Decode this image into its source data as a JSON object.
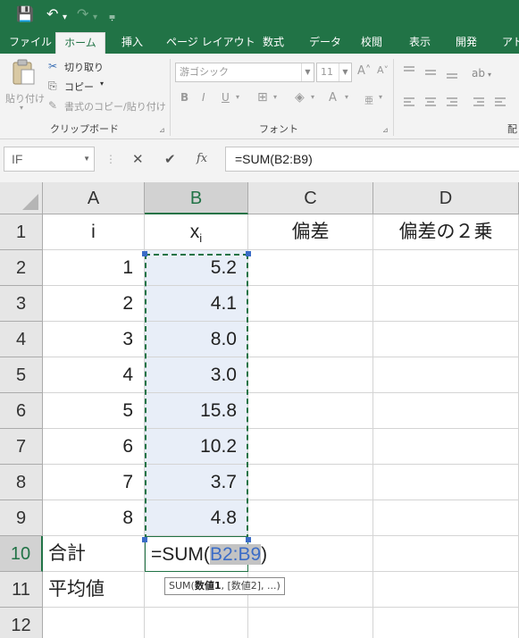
{
  "quick_access": {
    "save_icon": "💾",
    "undo_icon": "↶",
    "redo_icon": "↷",
    "dropdown_icon": "▾",
    "more_icon": "⩦"
  },
  "ribbon_tabs": [
    "ファイル",
    "ホーム",
    "挿入",
    "ページ レイアウト",
    "数式",
    "データ",
    "校閲",
    "表示",
    "開発",
    "アド"
  ],
  "clipboard": {
    "paste_label": "貼り付け",
    "cut_label": "切り取り",
    "copy_label": "コピー",
    "format_painter_label": "書式のコピー/貼り付け",
    "group_label": "クリップボード"
  },
  "font": {
    "font_name": "游ゴシック",
    "font_size": "11",
    "group_label": "フォント",
    "grow_icon": "A˄",
    "shrink_icon": "A˅",
    "bold": "B",
    "italic": "I",
    "underline": "U",
    "font_color_icon": "A",
    "fill_icon": "◈",
    "border_icon": "⊞"
  },
  "alignment": {
    "group_label": "配"
  },
  "formula_bar": {
    "name_box": "IF",
    "cancel_icon": "✕",
    "enter_icon": "✔",
    "fx_icon": "fx",
    "formula": "=SUM(B2:B9)"
  },
  "grid": {
    "columns": [
      "A",
      "B",
      "C",
      "D"
    ],
    "rows": [
      "1",
      "2",
      "3",
      "4",
      "5",
      "6",
      "7",
      "8",
      "9",
      "10",
      "11",
      "12"
    ],
    "header_row": {
      "a": "i",
      "b_main": "x",
      "b_sub": "i",
      "c": "偏差",
      "d": "偏差の２乗"
    },
    "a_values": [
      "1",
      "2",
      "3",
      "4",
      "5",
      "6",
      "7",
      "8"
    ],
    "b_values": [
      "5.2",
      "4.1",
      "8.0",
      "3.0",
      "15.8",
      "10.2",
      "3.7",
      "4.8"
    ],
    "sum_label": "合計",
    "avg_label": "平均値",
    "edit_prefix": "=SUM(",
    "edit_ref": "B2:B9",
    "edit_suffix": ")"
  },
  "tooltip": {
    "fn": "SUM(",
    "arg1": "数値1",
    "rest": ", [数値2], ...)"
  }
}
